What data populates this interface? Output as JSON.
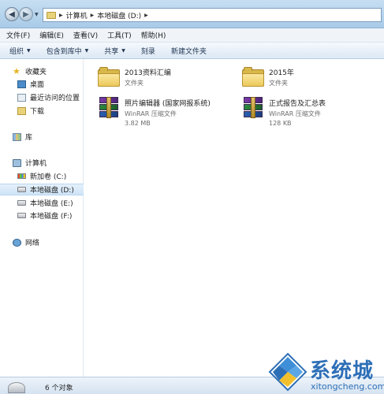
{
  "address_bar": {
    "crumbs": [
      "计算机",
      "本地磁盘 (D:)"
    ]
  },
  "menu": [
    "文件(F)",
    "编辑(E)",
    "查看(V)",
    "工具(T)",
    "帮助(H)"
  ],
  "commands": [
    {
      "label": "组织",
      "has_dropdown": true
    },
    {
      "label": "包含到库中",
      "has_dropdown": true
    },
    {
      "label": "共享",
      "has_dropdown": true
    },
    {
      "label": "刻录",
      "has_dropdown": false
    },
    {
      "label": "新建文件夹",
      "has_dropdown": false
    }
  ],
  "nav": {
    "favorites": {
      "label": "收藏夹",
      "icon": "star-icon"
    },
    "favorites_items": [
      {
        "label": "桌面",
        "icon": "desktop-icon"
      },
      {
        "label": "最近访问的位置",
        "icon": "recent-places-icon"
      },
      {
        "label": "下载",
        "icon": "downloads-icon"
      }
    ],
    "libraries": {
      "label": "库",
      "icon": "library-icon"
    },
    "computer": {
      "label": "计算机",
      "icon": "computer-icon"
    },
    "drives": [
      {
        "label": "新加卷 (C:)",
        "icon": "system-drive-icon",
        "selected": false
      },
      {
        "label": "本地磁盘 (D:)",
        "icon": "drive-icon",
        "selected": true
      },
      {
        "label": "本地磁盘 (E:)",
        "icon": "drive-icon",
        "selected": false
      },
      {
        "label": "本地磁盘 (F:)",
        "icon": "drive-icon",
        "selected": false
      }
    ],
    "network": {
      "label": "网络",
      "icon": "network-icon"
    }
  },
  "files": [
    {
      "name": "2013资料汇编",
      "type": "文件夹",
      "size": "",
      "icon": "folder-icon"
    },
    {
      "name": "2015年",
      "type": "文件夹",
      "size": "",
      "icon": "folder-icon"
    },
    {
      "name": "照片编辑器 (国家网报系统)",
      "type": "WinRAR 压缩文件",
      "size": "3.82 MB",
      "icon": "winrar-archive-icon"
    },
    {
      "name": "正式报告及汇总表",
      "type": "WinRAR 压缩文件",
      "size": "128 KB",
      "icon": "winrar-archive-icon"
    }
  ],
  "status": {
    "text": "6 个对象"
  },
  "watermark": {
    "cn": "系统城",
    "en": "xitongcheng.com"
  },
  "colors": {
    "title_bar": "#b9d4ee",
    "selection": "#cde4f7",
    "watermark": "#2d6fb7"
  }
}
